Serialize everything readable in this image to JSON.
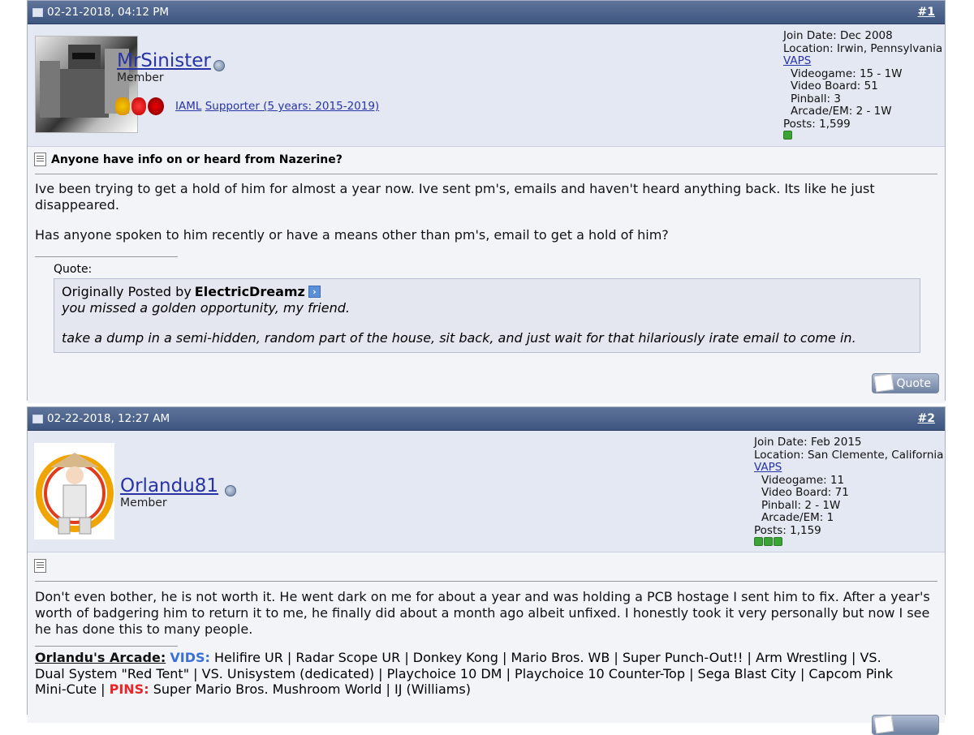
{
  "posts": [
    {
      "date": "02-21-2018, 04:12 PM",
      "number": "#1",
      "username": "MrSinister",
      "usertitle": "Member",
      "supporter_prefix": "IAML",
      "supporter_link": "Supporter (5 years: 2015-2019)",
      "stats": {
        "join_date": "Join Date: Dec 2008",
        "location": "Location: Irwin, Pennsylvania",
        "group": "VAPS",
        "videogame": "Videogame: 15 - 1W",
        "video_board": "Video Board: 51",
        "pinball": "Pinball: 3",
        "arcade": "Arcade/EM: 2 - 1W",
        "posts": "Posts: 1,599"
      },
      "title": "Anyone have info on or heard from Nazerine?",
      "body_p1": "Ive been trying to get a hold of him for almost a year now. Ive sent pm's, emails and haven't heard anything back. Its like he just disappeared.",
      "body_p2": "Has anyone spoken to him recently or have a means other than pm's, email to get a hold of him?",
      "quote_label": "Quote:",
      "quote_prefix": "Originally Posted by",
      "quote_author": "ElectricDreamz",
      "quote_line1": "you missed a golden opportunity, my friend.",
      "quote_line2": "take a dump in a semi-hidden, random part of the house, sit back, and just wait for that hilariously irate email to come in.",
      "quote_button": "Quote"
    },
    {
      "date": "02-22-2018, 12:27 AM",
      "number": "#2",
      "username": "Orlandu81",
      "usertitle": "Member",
      "stats": {
        "join_date": "Join Date: Feb 2015",
        "location": "Location: San Clemente, California",
        "group": "VAPS",
        "videogame": "Videogame: 11",
        "video_board": "Video Board: 71",
        "pinball": "Pinball: 2 - 1W",
        "arcade": "Arcade/EM: 1",
        "posts": "Posts: 1,159"
      },
      "body": "Don't even bother, he is not worth it. He went dark on me for about a year and was holding a PCB hostage I sent him to fix. After a year's worth of badgering him to return it to me, he finally did about a month ago albeit unfixed. I honestly took it very personally but now I see he has done this to many people.",
      "sig_arcade": "Orlandu's Arcade:",
      "sig_vids_label": "VIDS:",
      "sig_vids": "Helifire UR | Radar Scope UR | Donkey Kong | Mario Bros. WB | Super Punch-Out!! | Arm Wrestling | VS. Dual System \"Red Tent\" | VS. Unisystem (dedicated) | Playchoice 10 DM | Playchoice 10 Counter-Top | Sega Blast City | Capcom Pink Mini-Cute |",
      "sig_pins_label": "PINS:",
      "sig_pins": "Super Mario Bros. Mushroom World | IJ (Williams)"
    }
  ],
  "colors": {
    "header": "#4a6290",
    "link": "#2833a6",
    "vids": "#3a6fd8",
    "pins": "#e8262a"
  }
}
